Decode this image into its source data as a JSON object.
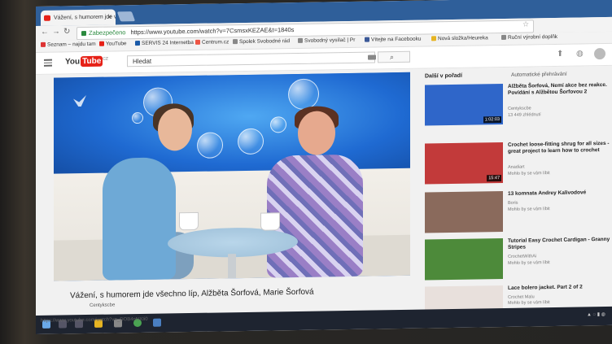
{
  "browser": {
    "tab_title": "Vážení, s humorem jde v",
    "tab_close": "✕",
    "secure_label": "Zabezpečeno",
    "url": "https://www.youtube.com/watch?v=7CsmsxKEZAE&t=1840s",
    "bookmarks": [
      {
        "label": "Seznam – najdu tam",
        "color": "#d33"
      },
      {
        "label": "YouTube",
        "color": "#e62117"
      },
      {
        "label": "SERVIS 24 Internetba",
        "color": "#1a5aa8"
      },
      {
        "label": "Centrum.cz",
        "color": "#e54"
      },
      {
        "label": "Spolek Svobodné rád",
        "color": "#888"
      },
      {
        "label": "Svobodný vysílač | Pr",
        "color": "#888"
      },
      {
        "label": "Vítejte na Facebooku",
        "color": "#3b5998"
      },
      {
        "label": "Nová složka/Heureka",
        "color": "#e6b422"
      },
      {
        "label": "Ruční výrobní doplňk",
        "color": "#888"
      }
    ]
  },
  "youtube": {
    "logo_text": "You",
    "logo_box": "Tube",
    "logo_cc": "CZ",
    "search_value": "Hledat",
    "video_title": "Vážení, s humorem jde všechno líp, Alžběta Šorfová, Marie Šorfová",
    "video_channel": "Centykscbe",
    "sidebar": {
      "heading": "Další v pořadí",
      "autoplay": "Automatické přehrávání",
      "items": [
        {
          "title": "Alžběta Šorfová, Nemí akce bez reakce. Povídání s Alžbětou Šorfovou 2",
          "channel": "Centykscbe",
          "meta": "13 449 zhlédnutí",
          "duration": "1:02:03",
          "bg": "#2f66c9"
        },
        {
          "title": "Crochet loose-fitting shrug for all sizes - great project to learn how to crochet",
          "channel": "Anadiart",
          "meta": "Mohlo by se vám líbit",
          "duration": "15:47",
          "bg": "#c23a3a"
        },
        {
          "title": "13 komnata Andrey Kalivodové",
          "channel": "Boris",
          "meta": "Mohlo by se vám líbit",
          "duration": "",
          "bg": "#8a6a5c"
        },
        {
          "title": "Tutorial Easy Crochet Cardigan - Granny Stripes",
          "channel": "CrochetWithAi",
          "meta": "Mohlo by se vám líbit",
          "duration": "",
          "bg": "#4d8a3a"
        },
        {
          "title": "Lace bolero jacket. Part 2 of 2",
          "channel": "Crochet Malu",
          "meta": "Mohlo by se vám líbit",
          "duration": "",
          "bg": "#e8e0dc"
        }
      ]
    }
  },
  "status_url": "https://www.youtube.com/watch?v=_DOB4nNXIi0"
}
